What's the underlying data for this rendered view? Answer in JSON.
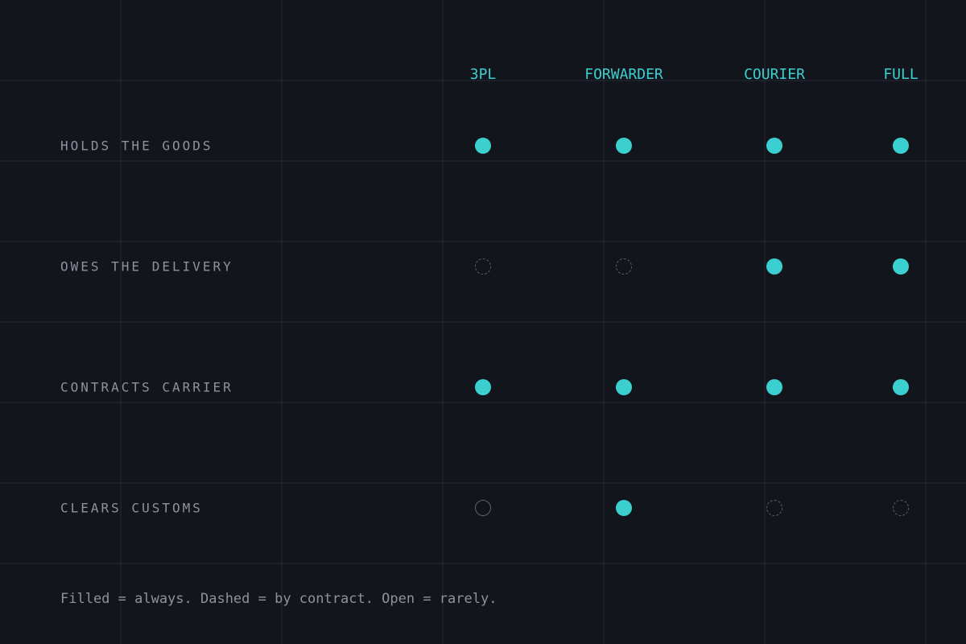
{
  "columns": [
    "3PL",
    "FORWARDER",
    "COURIER",
    "FULL"
  ],
  "rows": [
    {
      "label": "HOLDS THE GOODS",
      "marks": [
        "filled",
        "filled",
        "filled",
        "filled"
      ]
    },
    {
      "label": "OWES THE DELIVERY",
      "marks": [
        "dashed",
        "dashed",
        "filled",
        "filled"
      ]
    },
    {
      "label": "CONTRACTS CARRIER",
      "marks": [
        "filled",
        "filled",
        "filled",
        "filled"
      ]
    },
    {
      "label": "CLEARS CUSTOMS",
      "marks": [
        "open",
        "filled",
        "dashed",
        "dashed"
      ]
    }
  ],
  "legend": "Filled = always. Dashed = by contract. Open = rarely.",
  "colors": {
    "accent": "#3ccfd0",
    "background": "#12151c",
    "gridline": "#252a33",
    "label": "#8d939c",
    "muted_mark": "#5a606b"
  }
}
